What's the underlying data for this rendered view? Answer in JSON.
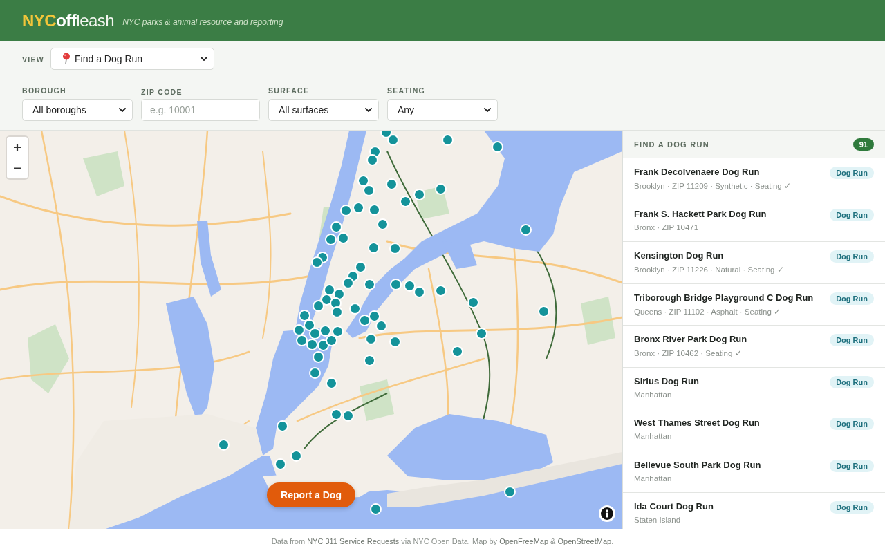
{
  "header": {
    "logo": {
      "accent": "NYC",
      "strong": "off",
      "rest": "leash"
    },
    "tagline": "NYC parks & animal resource and reporting"
  },
  "view_bar": {
    "label": "VIEW",
    "select": {
      "value": "Find a Dog Run"
    }
  },
  "filters": [
    {
      "kind": "select",
      "label": "BOROUGH",
      "value": "All boroughs"
    },
    {
      "kind": "input",
      "label": "ZIP CODE",
      "placeholder": "e.g. 10001"
    },
    {
      "kind": "select",
      "label": "SURFACE",
      "value": "All surfaces"
    },
    {
      "kind": "select",
      "label": "SEATING",
      "value": "Any"
    }
  ],
  "map": {
    "report_button": "Report a Dog"
  },
  "results": {
    "title": "FIND A DOG RUN",
    "count": "91",
    "items": [
      {
        "name": "Frank Decolvenaere Dog Run",
        "meta": "Brooklyn · ZIP 11209 · Synthetic · Seating ✓",
        "tag": "Dog Run"
      },
      {
        "name": "Frank S. Hackett Park Dog Run",
        "meta": "Bronx · ZIP 10471",
        "tag": "Dog Run"
      },
      {
        "name": "Kensington Dog Run",
        "meta": "Brooklyn · ZIP 11226 · Natural · Seating ✓",
        "tag": "Dog Run"
      },
      {
        "name": "Triborough Bridge Playground C Dog Run",
        "meta": "Queens · ZIP 11102 · Asphalt · Seating ✓",
        "tag": "Dog Run"
      },
      {
        "name": "Bronx River Park Dog Run",
        "meta": "Bronx · ZIP 10462 · Seating ✓",
        "tag": "Dog Run"
      },
      {
        "name": "Sirius Dog Run",
        "meta": "Manhattan",
        "tag": "Dog Run"
      },
      {
        "name": "West Thames Street Dog Run",
        "meta": "Manhattan",
        "tag": "Dog Run"
      },
      {
        "name": "Bellevue South Park Dog Run",
        "meta": "Manhattan",
        "tag": "Dog Run"
      },
      {
        "name": "Ida Court Dog Run",
        "meta": "Staten Island",
        "tag": "Dog Run"
      }
    ]
  },
  "footer": {
    "credits": [
      {
        "kind": "text",
        "text": "Data from "
      },
      {
        "kind": "link",
        "text": "NYC 311 Service Requests"
      },
      {
        "kind": "text",
        "text": " via NYC Open Data. Map by "
      },
      {
        "kind": "link",
        "text": "OpenFreeMap"
      },
      {
        "kind": "text",
        "text": " & "
      },
      {
        "kind": "link",
        "text": "OpenStreetMap"
      },
      {
        "kind": "text",
        "text": "."
      }
    ]
  }
}
